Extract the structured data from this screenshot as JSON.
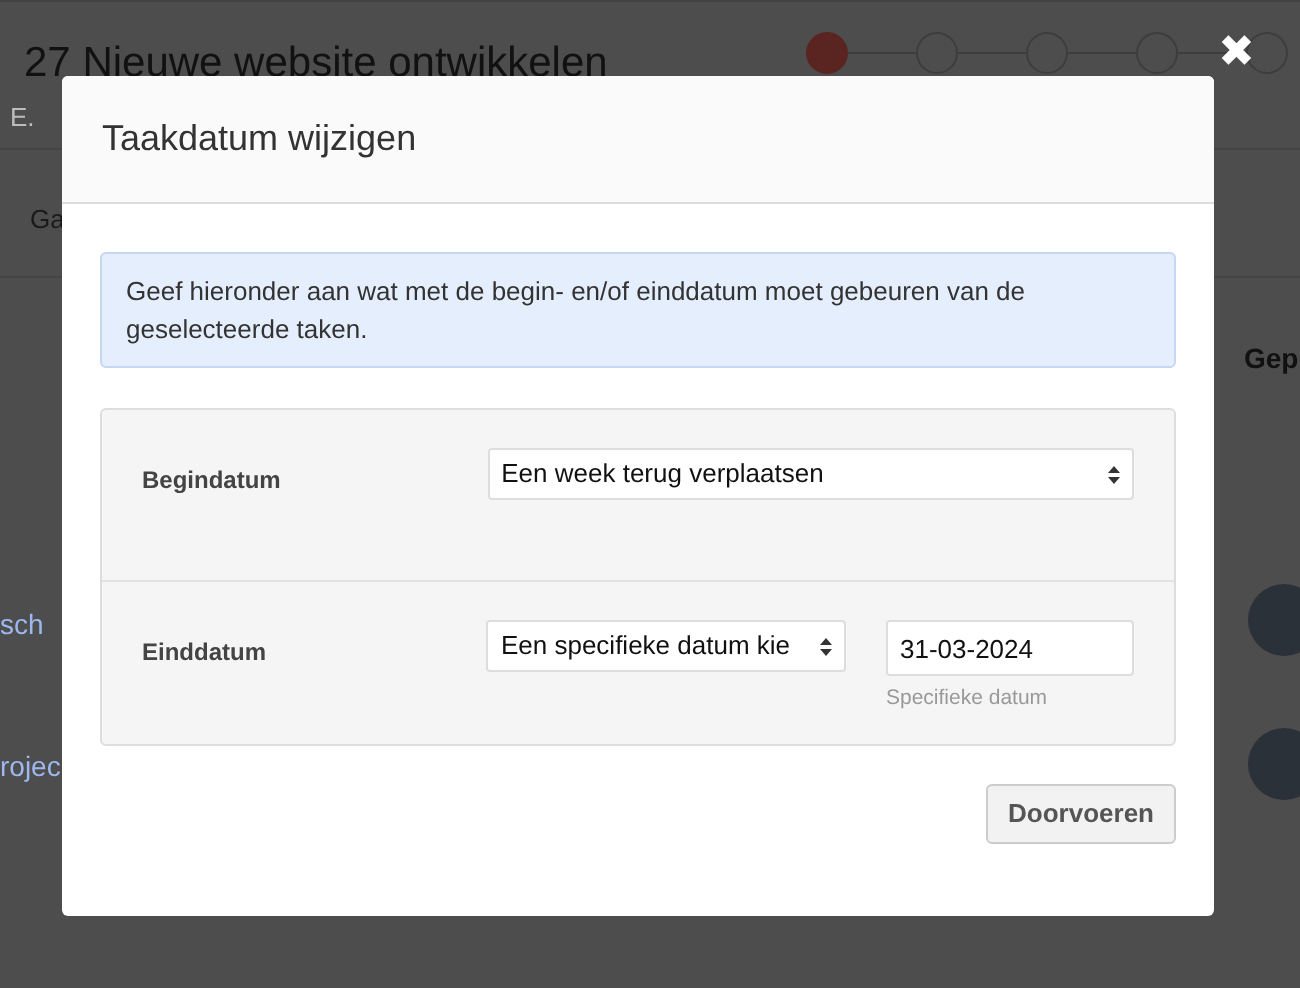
{
  "background": {
    "title": "27 Nieuwe website ontwikkelen",
    "subtitle": "E.",
    "tab": "Ga",
    "column": "Gep",
    "links": [
      "sch",
      "rojec"
    ],
    "steps": [
      {
        "selected": true
      },
      {
        "selected": false
      },
      {
        "selected": false
      },
      {
        "selected": false
      },
      {
        "selected": false
      }
    ]
  },
  "modal": {
    "title": "Taakdatum wijzigen",
    "close": "✖",
    "info": "Geef hieronder aan wat met de begin- en/of einddatum moet gebeuren van de geselecteerde taken.",
    "fields": [
      {
        "kind": "select",
        "label": "Begindatum",
        "value": "Een week terug verplaatsen"
      },
      {
        "kind": "select-date",
        "label": "Einddatum",
        "value": "Een specifieke datum kie",
        "date": "31-03-2024",
        "help": "Specifieke datum"
      }
    ],
    "button": "Doorvoeren"
  }
}
